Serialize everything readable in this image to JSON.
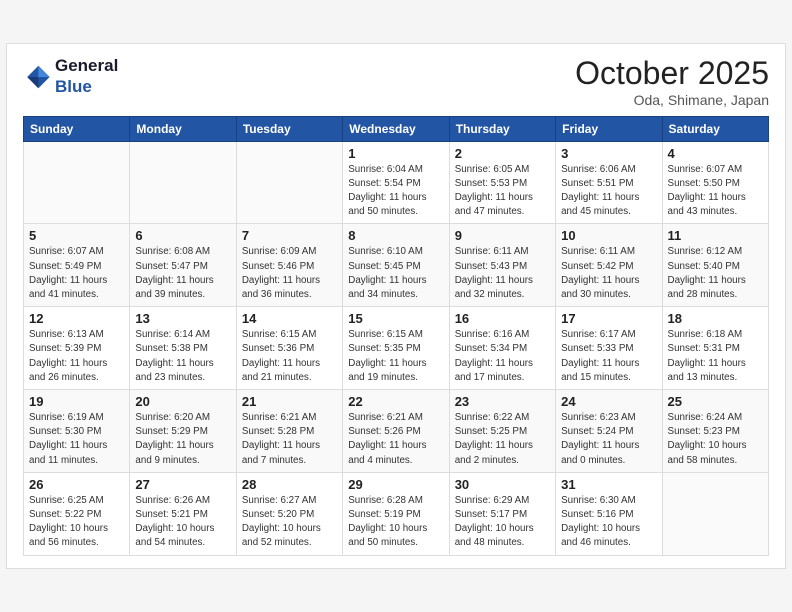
{
  "logo": {
    "line1": "General",
    "line2": "Blue"
  },
  "title": "October 2025",
  "location": "Oda, Shimane, Japan",
  "weekdays": [
    "Sunday",
    "Monday",
    "Tuesday",
    "Wednesday",
    "Thursday",
    "Friday",
    "Saturday"
  ],
  "weeks": [
    [
      {
        "day": "",
        "info": ""
      },
      {
        "day": "",
        "info": ""
      },
      {
        "day": "",
        "info": ""
      },
      {
        "day": "1",
        "info": "Sunrise: 6:04 AM\nSunset: 5:54 PM\nDaylight: 11 hours\nand 50 minutes."
      },
      {
        "day": "2",
        "info": "Sunrise: 6:05 AM\nSunset: 5:53 PM\nDaylight: 11 hours\nand 47 minutes."
      },
      {
        "day": "3",
        "info": "Sunrise: 6:06 AM\nSunset: 5:51 PM\nDaylight: 11 hours\nand 45 minutes."
      },
      {
        "day": "4",
        "info": "Sunrise: 6:07 AM\nSunset: 5:50 PM\nDaylight: 11 hours\nand 43 minutes."
      }
    ],
    [
      {
        "day": "5",
        "info": "Sunrise: 6:07 AM\nSunset: 5:49 PM\nDaylight: 11 hours\nand 41 minutes."
      },
      {
        "day": "6",
        "info": "Sunrise: 6:08 AM\nSunset: 5:47 PM\nDaylight: 11 hours\nand 39 minutes."
      },
      {
        "day": "7",
        "info": "Sunrise: 6:09 AM\nSunset: 5:46 PM\nDaylight: 11 hours\nand 36 minutes."
      },
      {
        "day": "8",
        "info": "Sunrise: 6:10 AM\nSunset: 5:45 PM\nDaylight: 11 hours\nand 34 minutes."
      },
      {
        "day": "9",
        "info": "Sunrise: 6:11 AM\nSunset: 5:43 PM\nDaylight: 11 hours\nand 32 minutes."
      },
      {
        "day": "10",
        "info": "Sunrise: 6:11 AM\nSunset: 5:42 PM\nDaylight: 11 hours\nand 30 minutes."
      },
      {
        "day": "11",
        "info": "Sunrise: 6:12 AM\nSunset: 5:40 PM\nDaylight: 11 hours\nand 28 minutes."
      }
    ],
    [
      {
        "day": "12",
        "info": "Sunrise: 6:13 AM\nSunset: 5:39 PM\nDaylight: 11 hours\nand 26 minutes."
      },
      {
        "day": "13",
        "info": "Sunrise: 6:14 AM\nSunset: 5:38 PM\nDaylight: 11 hours\nand 23 minutes."
      },
      {
        "day": "14",
        "info": "Sunrise: 6:15 AM\nSunset: 5:36 PM\nDaylight: 11 hours\nand 21 minutes."
      },
      {
        "day": "15",
        "info": "Sunrise: 6:15 AM\nSunset: 5:35 PM\nDaylight: 11 hours\nand 19 minutes."
      },
      {
        "day": "16",
        "info": "Sunrise: 6:16 AM\nSunset: 5:34 PM\nDaylight: 11 hours\nand 17 minutes."
      },
      {
        "day": "17",
        "info": "Sunrise: 6:17 AM\nSunset: 5:33 PM\nDaylight: 11 hours\nand 15 minutes."
      },
      {
        "day": "18",
        "info": "Sunrise: 6:18 AM\nSunset: 5:31 PM\nDaylight: 11 hours\nand 13 minutes."
      }
    ],
    [
      {
        "day": "19",
        "info": "Sunrise: 6:19 AM\nSunset: 5:30 PM\nDaylight: 11 hours\nand 11 minutes."
      },
      {
        "day": "20",
        "info": "Sunrise: 6:20 AM\nSunset: 5:29 PM\nDaylight: 11 hours\nand 9 minutes."
      },
      {
        "day": "21",
        "info": "Sunrise: 6:21 AM\nSunset: 5:28 PM\nDaylight: 11 hours\nand 7 minutes."
      },
      {
        "day": "22",
        "info": "Sunrise: 6:21 AM\nSunset: 5:26 PM\nDaylight: 11 hours\nand 4 minutes."
      },
      {
        "day": "23",
        "info": "Sunrise: 6:22 AM\nSunset: 5:25 PM\nDaylight: 11 hours\nand 2 minutes."
      },
      {
        "day": "24",
        "info": "Sunrise: 6:23 AM\nSunset: 5:24 PM\nDaylight: 11 hours\nand 0 minutes."
      },
      {
        "day": "25",
        "info": "Sunrise: 6:24 AM\nSunset: 5:23 PM\nDaylight: 10 hours\nand 58 minutes."
      }
    ],
    [
      {
        "day": "26",
        "info": "Sunrise: 6:25 AM\nSunset: 5:22 PM\nDaylight: 10 hours\nand 56 minutes."
      },
      {
        "day": "27",
        "info": "Sunrise: 6:26 AM\nSunset: 5:21 PM\nDaylight: 10 hours\nand 54 minutes."
      },
      {
        "day": "28",
        "info": "Sunrise: 6:27 AM\nSunset: 5:20 PM\nDaylight: 10 hours\nand 52 minutes."
      },
      {
        "day": "29",
        "info": "Sunrise: 6:28 AM\nSunset: 5:19 PM\nDaylight: 10 hours\nand 50 minutes."
      },
      {
        "day": "30",
        "info": "Sunrise: 6:29 AM\nSunset: 5:17 PM\nDaylight: 10 hours\nand 48 minutes."
      },
      {
        "day": "31",
        "info": "Sunrise: 6:30 AM\nSunset: 5:16 PM\nDaylight: 10 hours\nand 46 minutes."
      },
      {
        "day": "",
        "info": ""
      }
    ]
  ]
}
